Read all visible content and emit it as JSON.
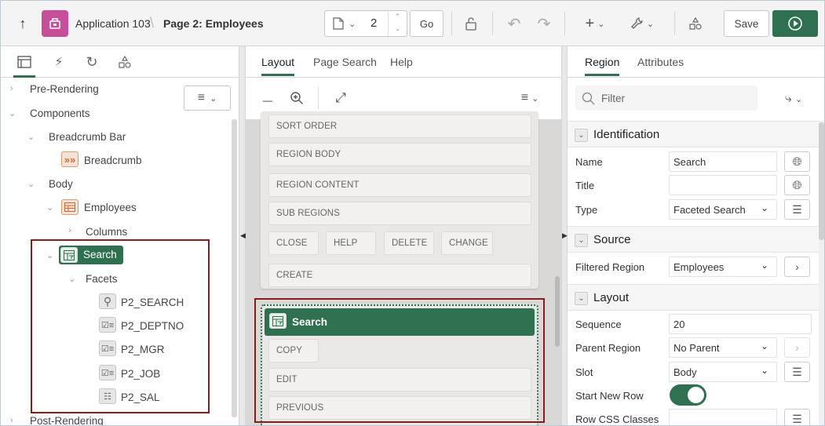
{
  "header": {
    "app_name": "Application 103",
    "page_title": "Page 2: Employees",
    "page_number": "2",
    "go_label": "Go",
    "save_label": "Save"
  },
  "left_panel": {
    "tree": {
      "pre_rendering": "Pre-Rendering",
      "components": "Components",
      "breadcrumb_bar": "Breadcrumb Bar",
      "breadcrumb": "Breadcrumb",
      "body": "Body",
      "employees": "Employees",
      "columns": "Columns",
      "search": "Search",
      "facets": "Facets",
      "facet_items": [
        "P2_SEARCH",
        "P2_DEPTNO",
        "P2_MGR",
        "P2_JOB",
        "P2_SAL"
      ],
      "post_rendering": "Post-Rendering"
    }
  },
  "middle_panel": {
    "tabs": [
      "Layout",
      "Page Search",
      "Help"
    ],
    "positions": {
      "sort_order": "SORT ORDER",
      "region_body": "REGION BODY",
      "region_content": "REGION CONTENT",
      "sub_regions": "SUB REGIONS",
      "close": "CLOSE",
      "help": "HELP",
      "delete": "DELETE",
      "change": "CHANGE",
      "create": "CREATE",
      "copy": "COPY",
      "edit": "EDIT",
      "previous": "PREVIOUS"
    },
    "search_region": "Search"
  },
  "right_panel": {
    "tabs": [
      "Region",
      "Attributes"
    ],
    "filter_placeholder": "Filter",
    "groups": {
      "identification": "Identification",
      "source": "Source",
      "layout": "Layout"
    },
    "props": {
      "name_label": "Name",
      "name_value": "Search",
      "title_label": "Title",
      "title_value": "",
      "type_label": "Type",
      "type_value": "Faceted Search",
      "filtered_region_label": "Filtered Region",
      "filtered_region_value": "Employees",
      "sequence_label": "Sequence",
      "sequence_value": "20",
      "parent_region_label": "Parent Region",
      "parent_region_value": "No Parent",
      "slot_label": "Slot",
      "slot_value": "Body",
      "start_new_row_label": "Start New Row",
      "start_new_row_value": true,
      "row_css_label": "Row CSS Classes",
      "row_css_value": ""
    }
  },
  "colors": {
    "accent_green": "#2e7050",
    "highlight_red": "#8b1a1a",
    "app_icon": "#c74e98"
  }
}
